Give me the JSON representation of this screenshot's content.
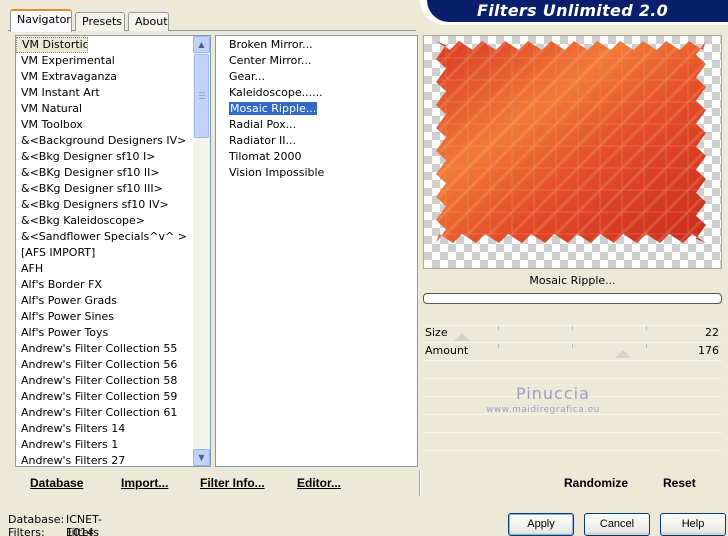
{
  "window": {
    "brand_title": "Filters Unlimited 2.0"
  },
  "tabs": [
    {
      "label": "Navigator"
    },
    {
      "label": "Presets"
    },
    {
      "label": "About"
    }
  ],
  "categories": [
    "VM Distortion",
    "VM Experimental",
    "VM Extravaganza",
    "VM Instant Art",
    "VM Natural",
    "VM Toolbox",
    "&<Background Designers IV>",
    "&<Bkg Designer sf10 I>",
    "&<BKg Designer sf10 II>",
    "&<BKg Designer sf10 III>",
    "&<Bkg Designers sf10 IV>",
    "&<Bkg Kaleidoscope>",
    "&<Sandflower Specials^v^ >",
    "[AFS IMPORT]",
    "AFH",
    "Alf's Border FX",
    "Alf's Power Grads",
    "Alf's Power Sines",
    "Alf's Power Toys",
    "Andrew's Filter Collection 55",
    "Andrew's Filter Collection 56",
    "Andrew's Filter Collection 58",
    "Andrew's Filter Collection 59",
    "Andrew's Filter Collection 61",
    "Andrew's Filters 14",
    "Andrew's Filters 1",
    "Andrew's Filters 27"
  ],
  "selected_category": "VM Distortion",
  "filters": [
    "Broken Mirror...",
    "Center Mirror...",
    "Gear...",
    "Kaleidoscope......",
    "Mosaic Ripple...",
    "Radial Pox...",
    "Radiator II...",
    "Tilomat 2000",
    "Vision Impossible"
  ],
  "selected_filter": "Mosaic Ripple...",
  "preview": {
    "filter_name": "Mosaic Ripple..."
  },
  "params": [
    {
      "label": "Size",
      "value": "22",
      "max": 255
    },
    {
      "label": "Amount",
      "value": "176",
      "max": 255
    }
  ],
  "watermark": {
    "name": "Pinuccia",
    "url": "www.maidiregrafica.eu"
  },
  "toolbar": {
    "database": "Database",
    "import": "Import...",
    "filter_info": "Filter Info...",
    "editor": "Editor...",
    "randomize": "Randomize",
    "reset": "Reset"
  },
  "status": {
    "database_label": "Database:",
    "database_value": "ICNET-Filters",
    "filters_label": "Filters:",
    "filters_value": "1014"
  },
  "buttons": {
    "apply": "Apply",
    "cancel": "Cancel",
    "help": "Help"
  },
  "colors": {
    "banner": "#0a1f6b",
    "selection": "#316ac5",
    "preview_orange": "#e8502a"
  }
}
